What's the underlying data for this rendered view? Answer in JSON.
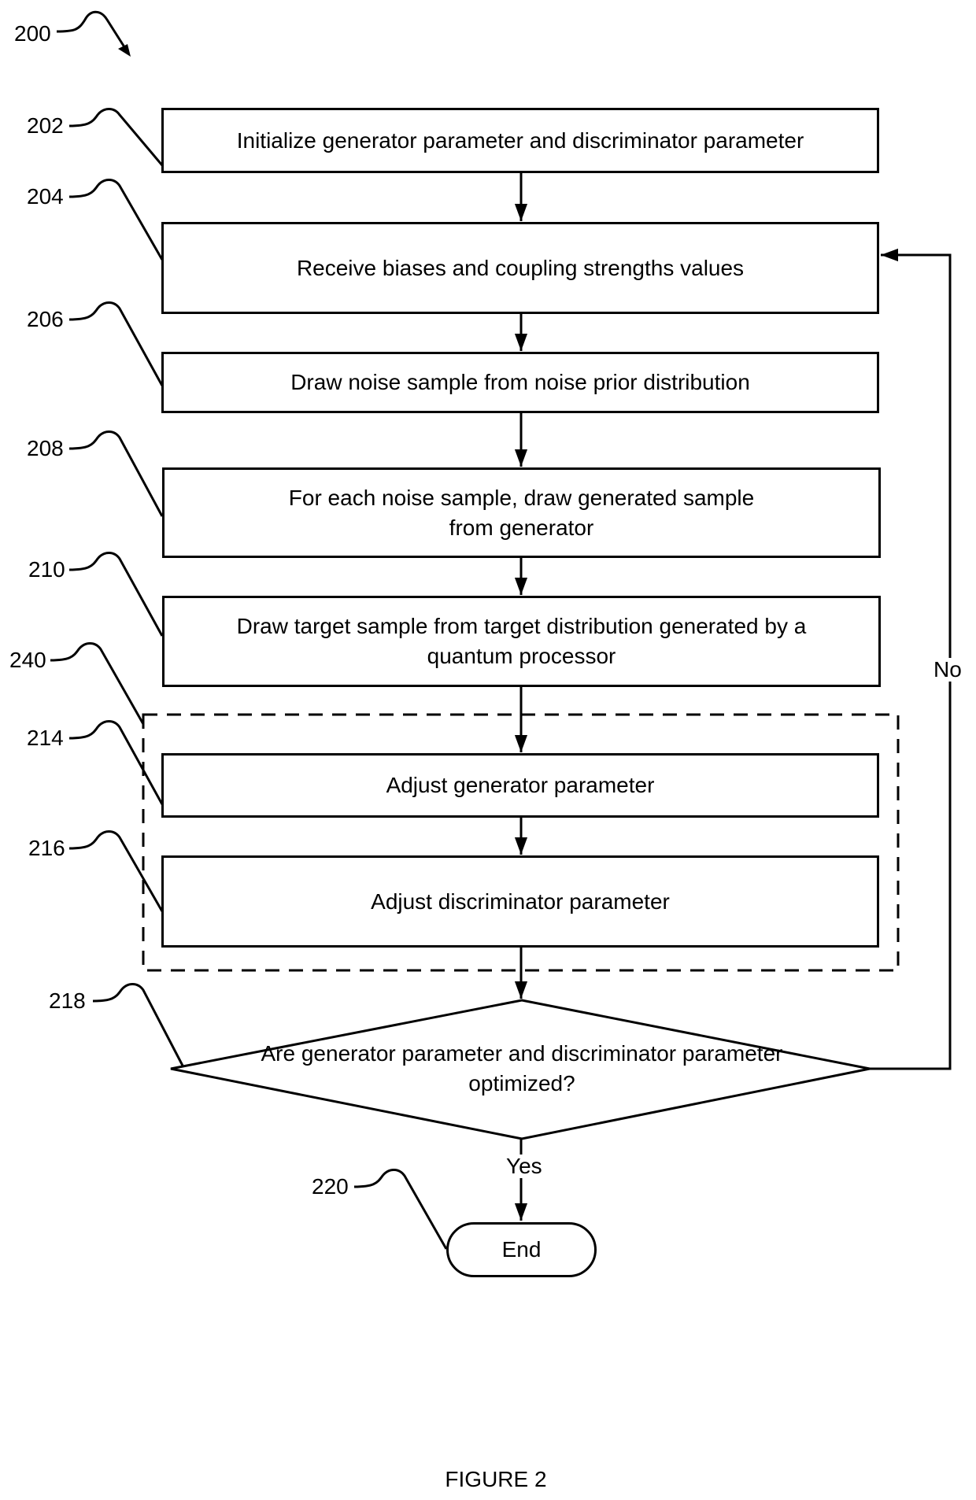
{
  "figure": {
    "caption": "FIGURE 2",
    "ref_main": "200"
  },
  "steps": [
    {
      "ref": "202",
      "text": "Initialize generator parameter and discriminator parameter"
    },
    {
      "ref": "204",
      "text": "Receive biases and coupling strengths values"
    },
    {
      "ref": "206",
      "text": "Draw noise sample from noise prior distribution"
    },
    {
      "ref": "208",
      "text": "For each noise sample, draw generated sample from generator"
    },
    {
      "ref": "210",
      "text": "Draw target sample from target distribution generated by a quantum processor"
    },
    {
      "ref": "214",
      "text": "Adjust generator parameter"
    },
    {
      "ref": "216",
      "text": "Adjust discriminator parameter"
    }
  ],
  "group": {
    "ref": "240"
  },
  "decision": {
    "ref": "218",
    "text": "Are generator parameter and discriminator parameter optimized?",
    "yes_label": "Yes",
    "no_label": "No"
  },
  "end": {
    "ref": "220",
    "text": "End"
  }
}
